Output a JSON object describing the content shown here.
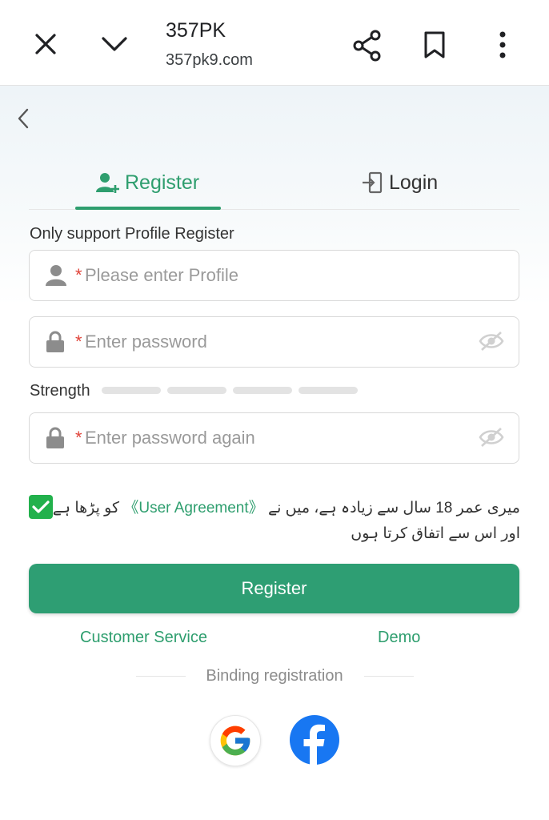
{
  "browser": {
    "title": "357PK",
    "url": "357pk9.com",
    "icons": [
      "close-icon",
      "chevron-down-icon",
      "share-icon",
      "bookmark-icon",
      "more-vertical-icon"
    ]
  },
  "tabs": {
    "register": "Register",
    "login": "Login"
  },
  "form": {
    "hint": "Only support Profile Register",
    "required_mark": "*",
    "profile_placeholder": "Please enter Profile",
    "password_placeholder": "Enter password",
    "password_again_placeholder": "Enter password again",
    "strength_label": "Strength",
    "strength_level": 0,
    "agreement_checked": true,
    "agreement_line1_before": "میری عمر 18 سال سے زیادہ ہے، میں نے",
    "agreement_link": "《User Agreement》",
    "agreement_line1_after": "کو پڑھا ہے",
    "agreement_line2": "اور اس سے اتفاق کرتا ہوں",
    "submit_label": "Register"
  },
  "links": {
    "customer_service": "Customer Service",
    "demo": "Demo"
  },
  "binding": {
    "label": "Binding registration",
    "providers": [
      "Google",
      "Facebook"
    ]
  },
  "colors": {
    "accent": "#2e9e6e",
    "button": "#2e9e73",
    "checkbox": "#22b14c",
    "required": "#e0443a",
    "facebook": "#1877f2"
  }
}
